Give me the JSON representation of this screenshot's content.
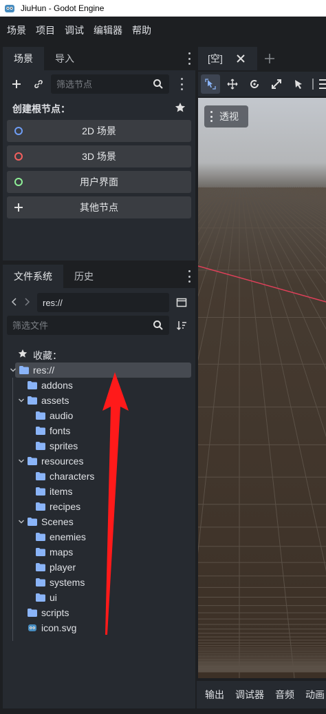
{
  "window": {
    "title": "JiuHun - Godot Engine"
  },
  "menubar": {
    "items": [
      "场景",
      "项目",
      "调试",
      "编辑器",
      "帮助"
    ]
  },
  "scene_dock": {
    "tabs": [
      "场景",
      "导入"
    ],
    "filter_placeholder": "筛选节点",
    "create_root_label": "创建根节点：",
    "buttons": [
      {
        "label": "2D 场景",
        "color": "#6e9df5"
      },
      {
        "label": "3D 场景",
        "color": "#f5605e"
      },
      {
        "label": "用户界面",
        "color": "#8eef97"
      },
      {
        "label": "其他节点"
      }
    ]
  },
  "filesystem_dock": {
    "tabs": [
      "文件系统",
      "历史"
    ],
    "path": "res://",
    "filter_placeholder": "筛选文件",
    "favorites_label": "收藏：",
    "tree": [
      {
        "label": "res://",
        "depth": 0,
        "expanded": true,
        "type": "folder",
        "selected": true
      },
      {
        "label": "addons",
        "depth": 1,
        "type": "folder"
      },
      {
        "label": "assets",
        "depth": 1,
        "expanded": true,
        "type": "folder"
      },
      {
        "label": "audio",
        "depth": 2,
        "type": "folder"
      },
      {
        "label": "fonts",
        "depth": 2,
        "type": "folder"
      },
      {
        "label": "sprites",
        "depth": 2,
        "type": "folder"
      },
      {
        "label": "resources",
        "depth": 1,
        "expanded": true,
        "type": "folder"
      },
      {
        "label": "characters",
        "depth": 2,
        "type": "folder"
      },
      {
        "label": "items",
        "depth": 2,
        "type": "folder"
      },
      {
        "label": "recipes",
        "depth": 2,
        "type": "folder"
      },
      {
        "label": "Scenes",
        "depth": 1,
        "expanded": true,
        "type": "folder"
      },
      {
        "label": "enemies",
        "depth": 2,
        "type": "folder"
      },
      {
        "label": "maps",
        "depth": 2,
        "type": "folder"
      },
      {
        "label": "player",
        "depth": 2,
        "type": "folder"
      },
      {
        "label": "systems",
        "depth": 2,
        "type": "folder"
      },
      {
        "label": "ui",
        "depth": 2,
        "type": "folder"
      },
      {
        "label": "scripts",
        "depth": 1,
        "type": "folder"
      },
      {
        "label": "icon.svg",
        "depth": 1,
        "type": "file"
      }
    ]
  },
  "viewport": {
    "tab_label": "[空]",
    "view_menu_label": "透视"
  },
  "bottom_panel": {
    "tabs": [
      "输出",
      "调试器",
      "音频",
      "动画"
    ]
  },
  "colors": {
    "accent": "#478cbf",
    "folder": "#8ab4f8",
    "annotation_arrow": "#ff1a1a"
  }
}
